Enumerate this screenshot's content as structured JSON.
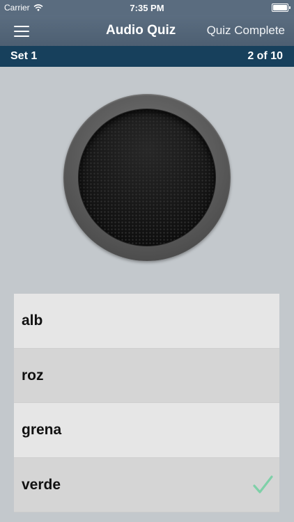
{
  "status_bar": {
    "carrier": "Carrier",
    "time": "7:35 PM",
    "wifi_icon": "wifi-icon",
    "battery_icon": "battery-icon"
  },
  "nav_bar": {
    "menu_icon": "hamburger-menu-icon",
    "title": "Audio Quiz",
    "right_button": "Quiz Complete"
  },
  "quiz_header": {
    "set_label": "Set 1",
    "progress": "2 of 10"
  },
  "speaker": {
    "icon": "speaker-play-button"
  },
  "answers": [
    {
      "label": "alb",
      "correct": false
    },
    {
      "label": "roz",
      "correct": false
    },
    {
      "label": "grena",
      "correct": false
    },
    {
      "label": "verde",
      "correct": true
    }
  ],
  "colors": {
    "nav_bar": "#4d5f72",
    "set_bar": "#17405c",
    "background": "#c3c8cc",
    "check": "#7fd0a8"
  }
}
